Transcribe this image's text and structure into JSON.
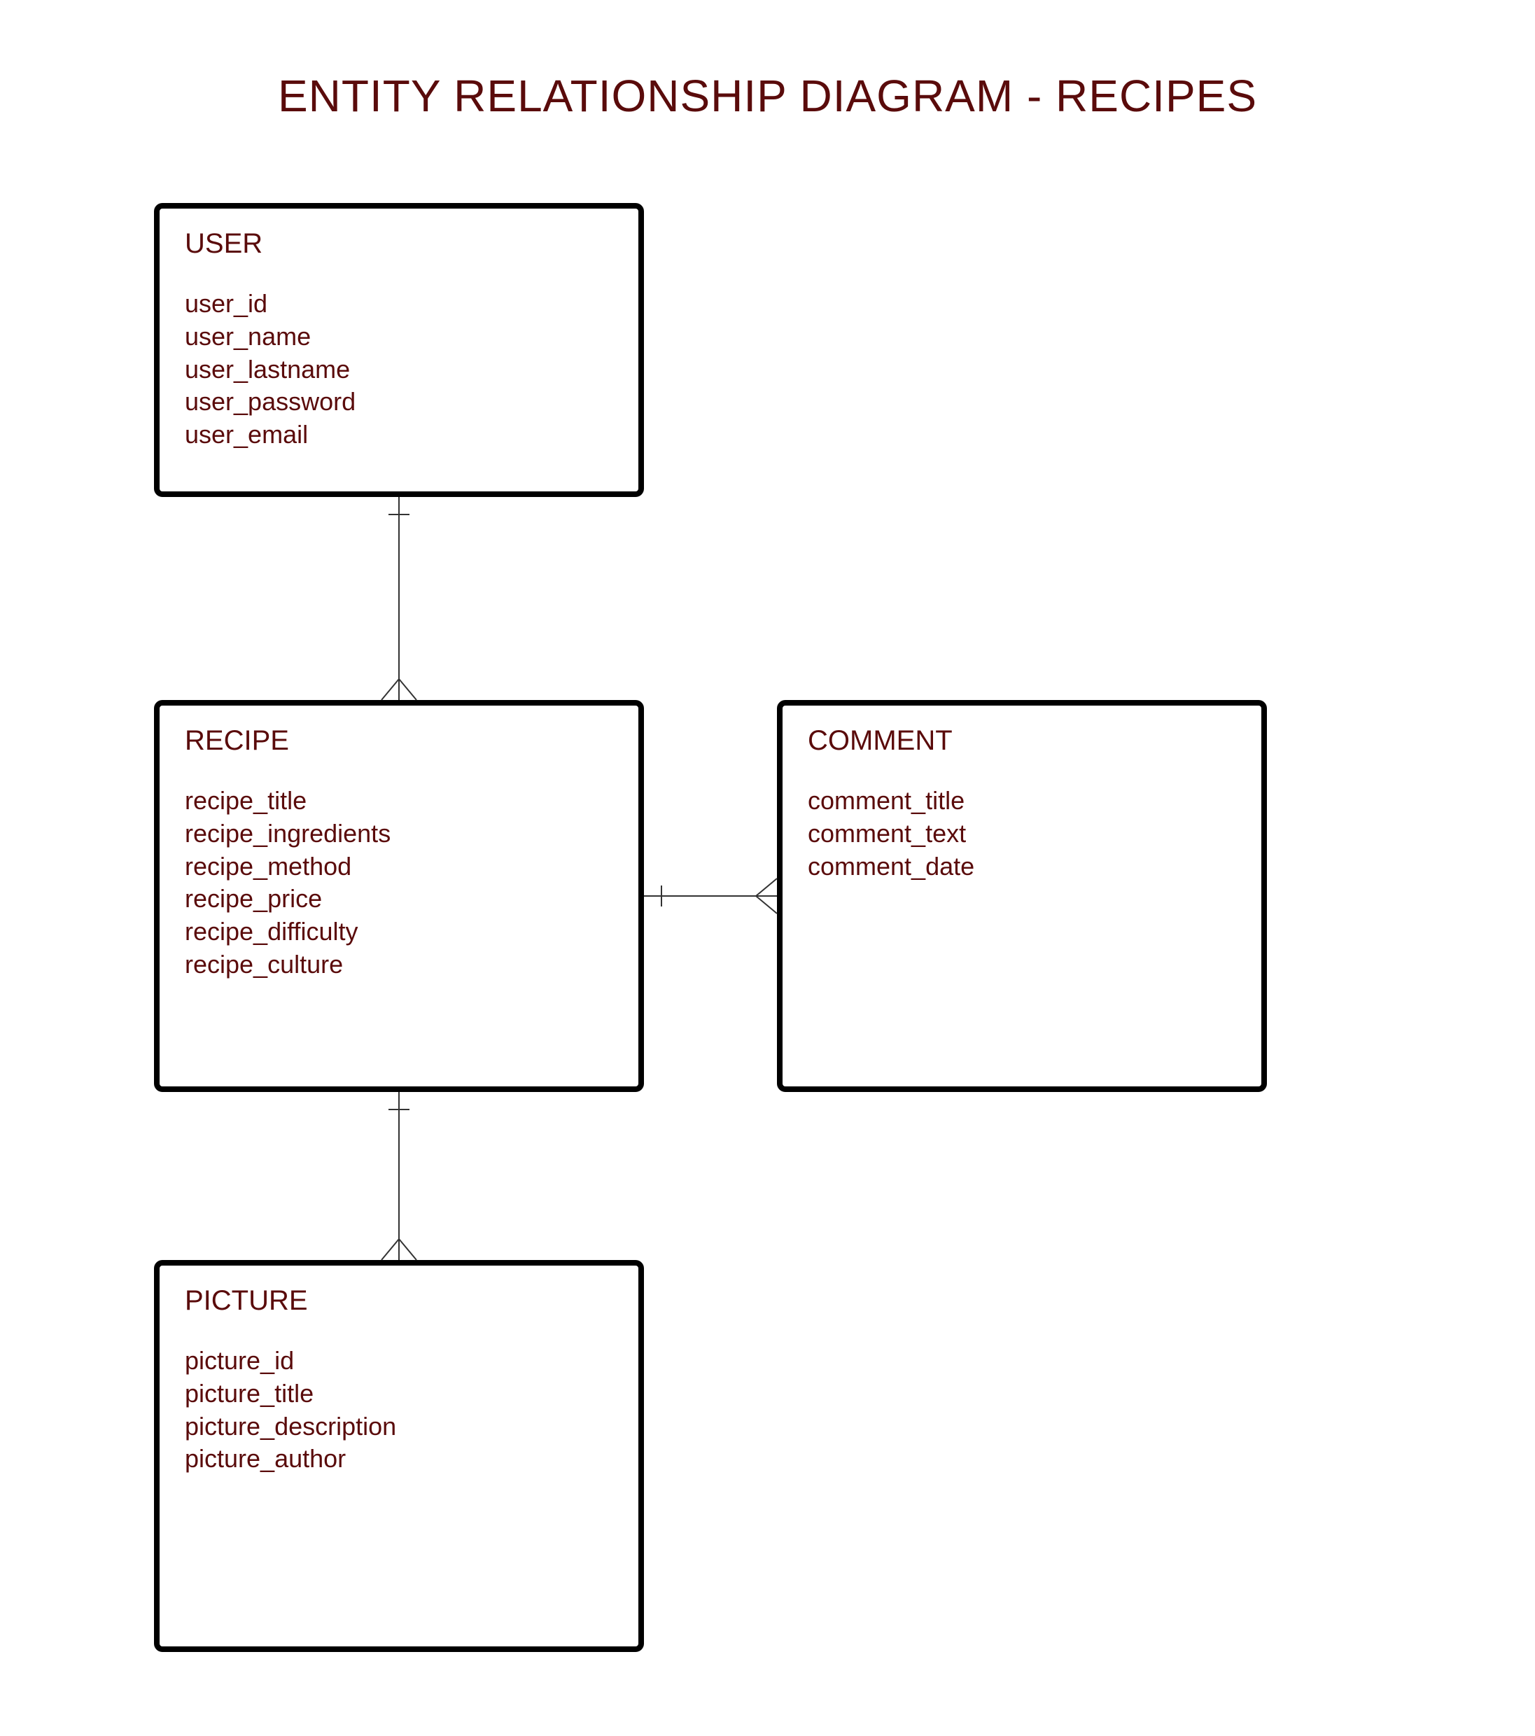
{
  "title": "ENTITY RELATIONSHIP DIAGRAM - RECIPES",
  "entities": {
    "user": {
      "name": "USER",
      "attrs": [
        "user_id",
        "user_name",
        "user_lastname",
        "user_password",
        "user_email"
      ]
    },
    "recipe": {
      "name": "RECIPE",
      "attrs": [
        "recipe_title",
        "recipe_ingredients",
        "recipe_method",
        "recipe_price",
        "recipe_difficulty",
        "recipe_culture"
      ]
    },
    "comment": {
      "name": "COMMENT",
      "attrs": [
        "comment_title",
        "comment_text",
        "comment_date"
      ]
    },
    "picture": {
      "name": "PICTURE",
      "attrs": [
        "picture_id",
        "picture_title",
        "picture_description",
        "picture_author"
      ]
    }
  },
  "relationships": [
    {
      "from": "user",
      "to": "recipe",
      "type": "one-to-many"
    },
    {
      "from": "recipe",
      "to": "comment",
      "type": "one-to-many"
    },
    {
      "from": "recipe",
      "to": "picture",
      "type": "one-to-many"
    }
  ]
}
